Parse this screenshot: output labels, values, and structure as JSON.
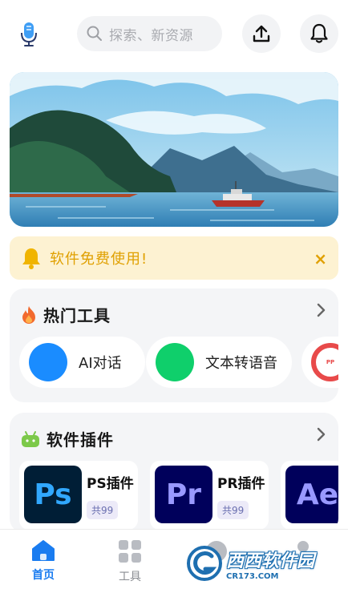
{
  "header": {
    "search_placeholder": "探索、新资源",
    "icons": {
      "mic": "mic-icon",
      "search": "search-icon",
      "upload": "upload-icon",
      "bell": "bell-icon"
    }
  },
  "notice": {
    "text": "软件免费使用!",
    "close": "×",
    "icon": "bell-icon",
    "color": "#e0a000"
  },
  "hot_tools": {
    "title": "热门工具",
    "icon": "fire-icon",
    "items": [
      {
        "label": "AI对话",
        "color": "#1a8cff"
      },
      {
        "label": "文本转语音",
        "color": "#0fcf6b"
      },
      {
        "label": "",
        "color": "#e84a4a"
      }
    ]
  },
  "plugins": {
    "title": "软件插件",
    "icon": "android-icon",
    "items": [
      {
        "logo": "Ps",
        "name": "PS插件",
        "count": "共99",
        "bg": "#001e36",
        "fg": "#31a8ff"
      },
      {
        "logo": "Pr",
        "name": "PR插件",
        "count": "共99",
        "bg": "#00005b",
        "fg": "#9999ff"
      },
      {
        "logo": "Ae",
        "name": "",
        "count": "",
        "bg": "#00005b",
        "fg": "#9999ff"
      }
    ]
  },
  "bottom_nav": [
    {
      "label": "首页",
      "active": true
    },
    {
      "label": "工具",
      "active": false
    }
  ],
  "watermark": {
    "text": "西西软件园",
    "url": "CR173.COM"
  },
  "colors": {
    "accent": "#1a7cf0",
    "card_bg": "#f4f5f7"
  }
}
